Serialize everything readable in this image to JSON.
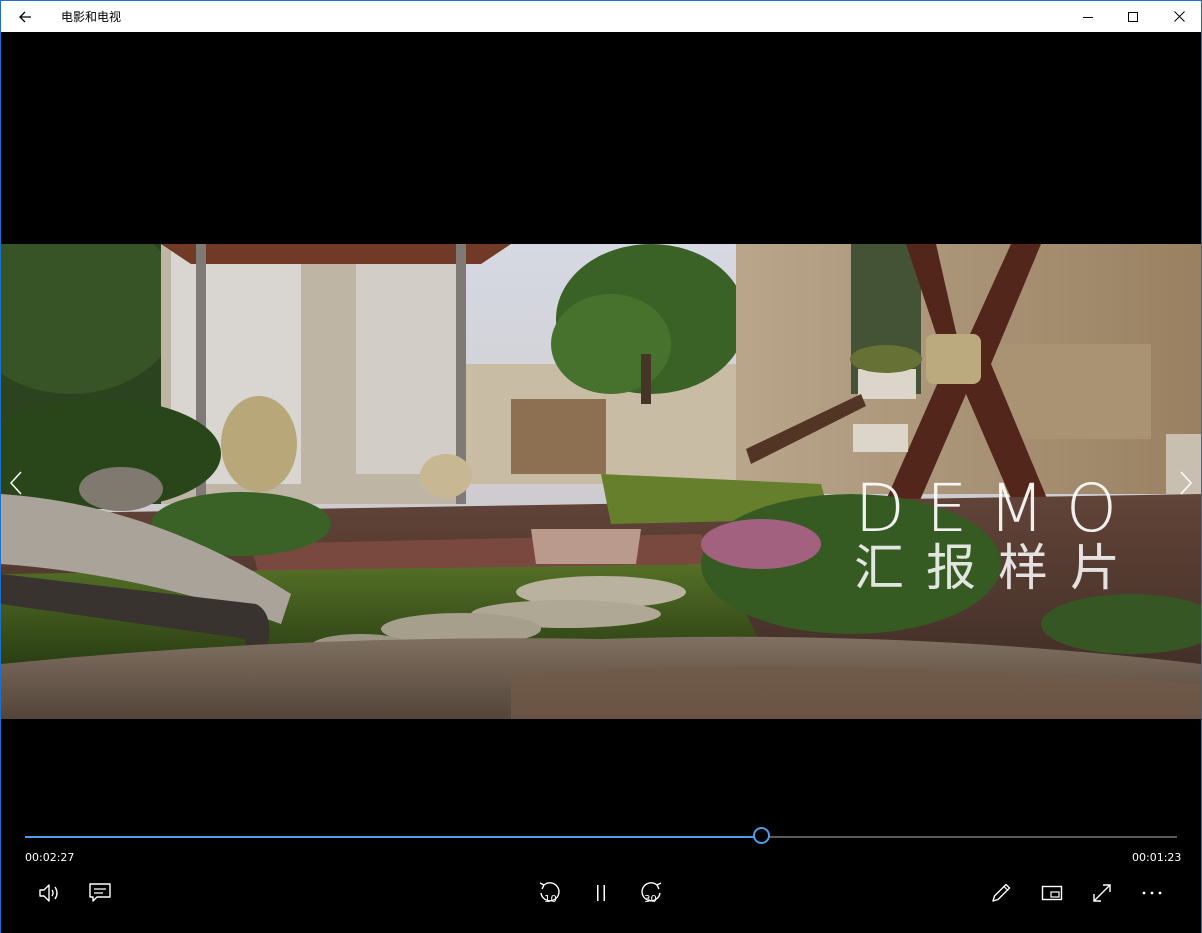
{
  "window": {
    "title": "电影和电视"
  },
  "video": {
    "watermark_line1": "DEMO",
    "watermark_line2": "汇报样片"
  },
  "playback": {
    "elapsed": "00:02:27",
    "remaining": "00:01:23",
    "progress_fraction": 0.639
  },
  "controls": {
    "skip_back_seconds": "10",
    "skip_forward_seconds": "30"
  },
  "icons": {
    "back": "arrow-left-icon",
    "minimize": "minimize-icon",
    "maximize": "maximize-icon",
    "close": "close-icon",
    "volume": "speaker-icon",
    "subtitles": "subtitles-icon",
    "pause": "pause-icon",
    "edit": "pencil-icon",
    "mini_view": "picture-in-picture-icon",
    "fullscreen": "expand-icon",
    "more": "more-dots-icon"
  },
  "colors": {
    "accent": "#4a9fe8",
    "frame": "#1e6fd0"
  }
}
